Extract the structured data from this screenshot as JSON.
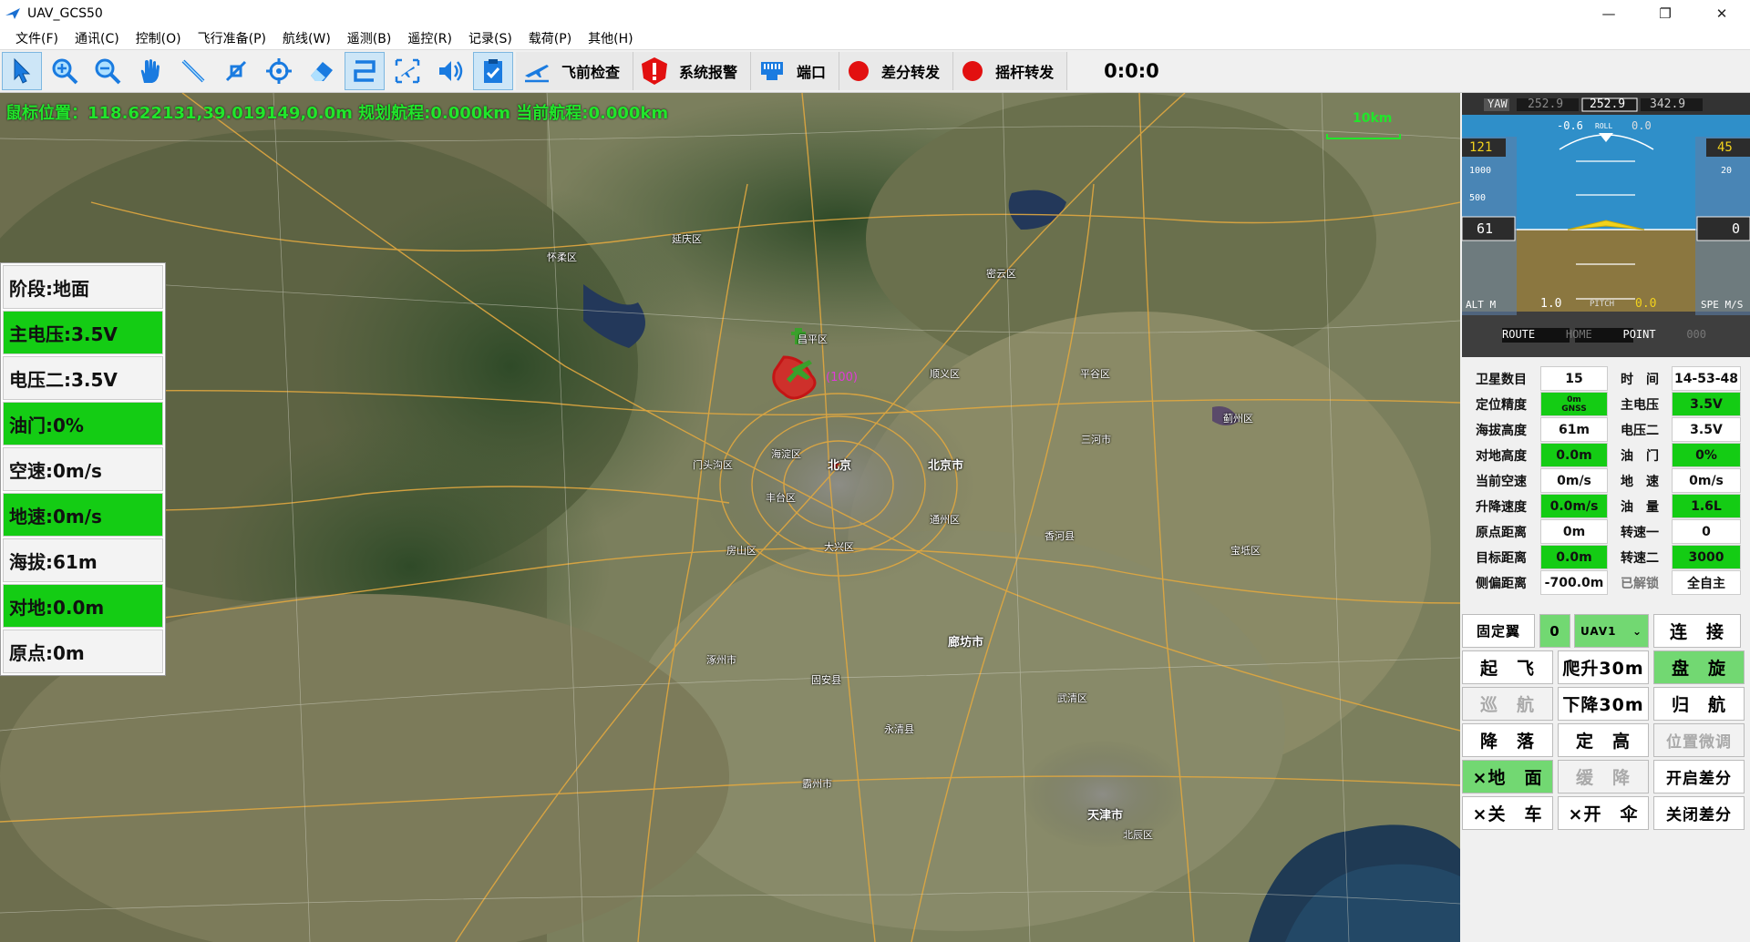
{
  "window": {
    "title": "UAV_GCS50",
    "minimize": "—",
    "maximize": "❐",
    "close": "✕"
  },
  "menu": [
    "文件(F)",
    "通讯(C)",
    "控制(O)",
    "飞行准备(P)",
    "航线(W)",
    "遥测(B)",
    "遥控(R)",
    "记录(S)",
    "载荷(P)",
    "其他(H)"
  ],
  "toolbar": {
    "preflight_label": "飞前检查",
    "alarm_label": "系统报警",
    "port_label": "端口",
    "diff_label": "差分转发",
    "stick_label": "摇杆转发",
    "timer": "0:0:0"
  },
  "map": {
    "coord_text": "鼠标位置：118.622131,39.019149,0.0m 规划航程:0.000km 当前航程:0.000km",
    "scale_label": "10km",
    "labels": [
      "北京",
      "北京市",
      "海淀区",
      "丰台区",
      "通州区",
      "昌平区",
      "顺义区",
      "怀柔区",
      "密云区",
      "平谷区",
      "延庆区",
      "门头沟区",
      "房山区",
      "大兴区",
      "廊坊市",
      "天津市",
      "三河市",
      "香河县",
      "固安县",
      "涿州市",
      "武清区",
      "北辰区",
      "宝坻区",
      "蓟州区",
      "永清县",
      "霸州市"
    ]
  },
  "status_panel": {
    "phase": "阶段:地面",
    "main_voltage": "主电压:3.5V",
    "voltage2": "电压二:3.5V",
    "throttle": "油门:0%",
    "airspeed": "空速:0m/s",
    "groundspeed": "地速:0m/s",
    "altitude": "海拔:61m",
    "agl": "对地:0.0m",
    "origin": "原点:0m"
  },
  "pfd": {
    "yaw_label": "YAW",
    "yaw1": "252.9",
    "yaw2": "252.9",
    "yaw3": "342.9",
    "roll_left": "-0.6",
    "roll_label": "ROLL",
    "roll_right": "0.0",
    "alt_top": "121",
    "alt_current": "61",
    "alt_label": "ALT M",
    "alt_ticks": [
      "1000",
      "500"
    ],
    "spd_top": "45",
    "spd_current": "0",
    "spd_label": "SPE M/S",
    "spd_ticks": [
      "20"
    ],
    "pitch_left": "1.0",
    "pitch_label": "PITCH",
    "pitch_right": "0.0",
    "modes": [
      "ROUTE",
      "HOME",
      "POINT",
      "000"
    ]
  },
  "telemetry": [
    {
      "label": "卫星数目",
      "value": "15",
      "green": false,
      "label2": "时　间",
      "value2": "14-53-48",
      "green2": false
    },
    {
      "label": "定位精度",
      "value": "0m\nGNSS",
      "green": true,
      "label2": "主电压",
      "value2": "3.5V",
      "green2": true
    },
    {
      "label": "海拔高度",
      "value": "61m",
      "green": false,
      "label2": "电压二",
      "value2": "3.5V",
      "green2": false
    },
    {
      "label": "对地高度",
      "value": "0.0m",
      "green": true,
      "label2": "油　门",
      "value2": "0%",
      "green2": true
    },
    {
      "label": "当前空速",
      "value": "0m/s",
      "green": false,
      "label2": "地　速",
      "value2": "0m/s",
      "green2": false
    },
    {
      "label": "升降速度",
      "value": "0.0m/s",
      "green": true,
      "label2": "油　量",
      "value2": "1.6L",
      "green2": true
    },
    {
      "label": "原点距离",
      "value": "0m",
      "green": false,
      "label2": "转速一",
      "value2": "0",
      "green2": false
    },
    {
      "label": "目标距离",
      "value": "0.0m",
      "green": true,
      "label2": "转速二",
      "value2": "3000",
      "green2": true
    },
    {
      "label": "侧偏距离",
      "value": "-700.0m",
      "green": false,
      "label2": "已解锁",
      "value2": "全自主",
      "green2": false
    }
  ],
  "controls": {
    "fixed_wing": "固定翼",
    "count": "0",
    "uav_select": "UAV1",
    "connect": "连　接",
    "takeoff": "起　飞",
    "climb": "爬升30m",
    "circle": "盘　旋",
    "cruise": "巡　航",
    "descend": "下降30m",
    "return": "归　航",
    "land": "降　落",
    "hold_alt": "定　高",
    "fine_tune": "位置微调",
    "ground": "×地　面",
    "slow_descend": "缓　降",
    "open_diff": "开启差分",
    "engine_off": "×关　车",
    "open_chute": "×开　伞",
    "close_diff": "关闭差分"
  },
  "colors": {
    "green": "#14cc14",
    "accent": "#21e62b"
  }
}
